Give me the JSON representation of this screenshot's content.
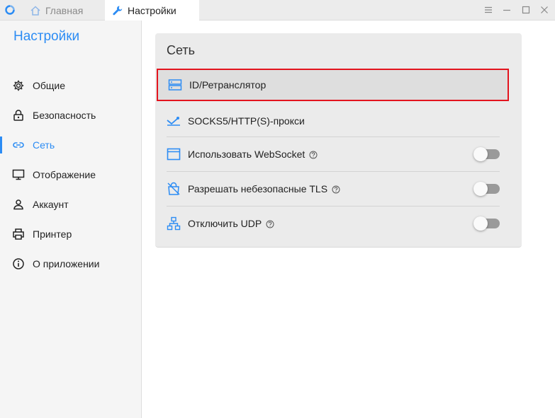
{
  "window": {
    "tabs": [
      {
        "label": "Главная",
        "icon": "home-icon"
      },
      {
        "label": "Настройки",
        "icon": "wrench-icon"
      }
    ],
    "controls": [
      "menu-icon",
      "minimize-icon",
      "maximize-icon",
      "close-icon"
    ]
  },
  "sidebar": {
    "title": "Настройки",
    "items": [
      {
        "label": "Общие",
        "icon": "gear-icon"
      },
      {
        "label": "Безопасность",
        "icon": "lock-icon"
      },
      {
        "label": "Сеть",
        "icon": "link-icon",
        "active": true
      },
      {
        "label": "Отображение",
        "icon": "monitor-icon"
      },
      {
        "label": "Аккаунт",
        "icon": "user-icon"
      },
      {
        "label": "Принтер",
        "icon": "printer-icon"
      },
      {
        "label": "О приложении",
        "icon": "info-icon"
      }
    ]
  },
  "network": {
    "title": "Сеть",
    "rows": [
      {
        "label": "ID/Ретранслятор",
        "icon": "server-icon"
      },
      {
        "label": "SOCKS5/HTTP(S)-прокси",
        "icon": "proxy-icon"
      },
      {
        "label": "Использовать WebSocket",
        "icon": "window-icon",
        "toggle": false
      },
      {
        "label": "Разрешать небезопасные TLS",
        "icon": "unlock-bag-icon",
        "toggle": false
      },
      {
        "label": "Отключить UDP",
        "icon": "network-icon",
        "toggle": false
      }
    ]
  },
  "colors": {
    "accent": "#2c8cf4",
    "highlight_border": "#e3141e",
    "sidebar_bg": "#f5f5f5",
    "card_bg": "#ebebeb"
  }
}
